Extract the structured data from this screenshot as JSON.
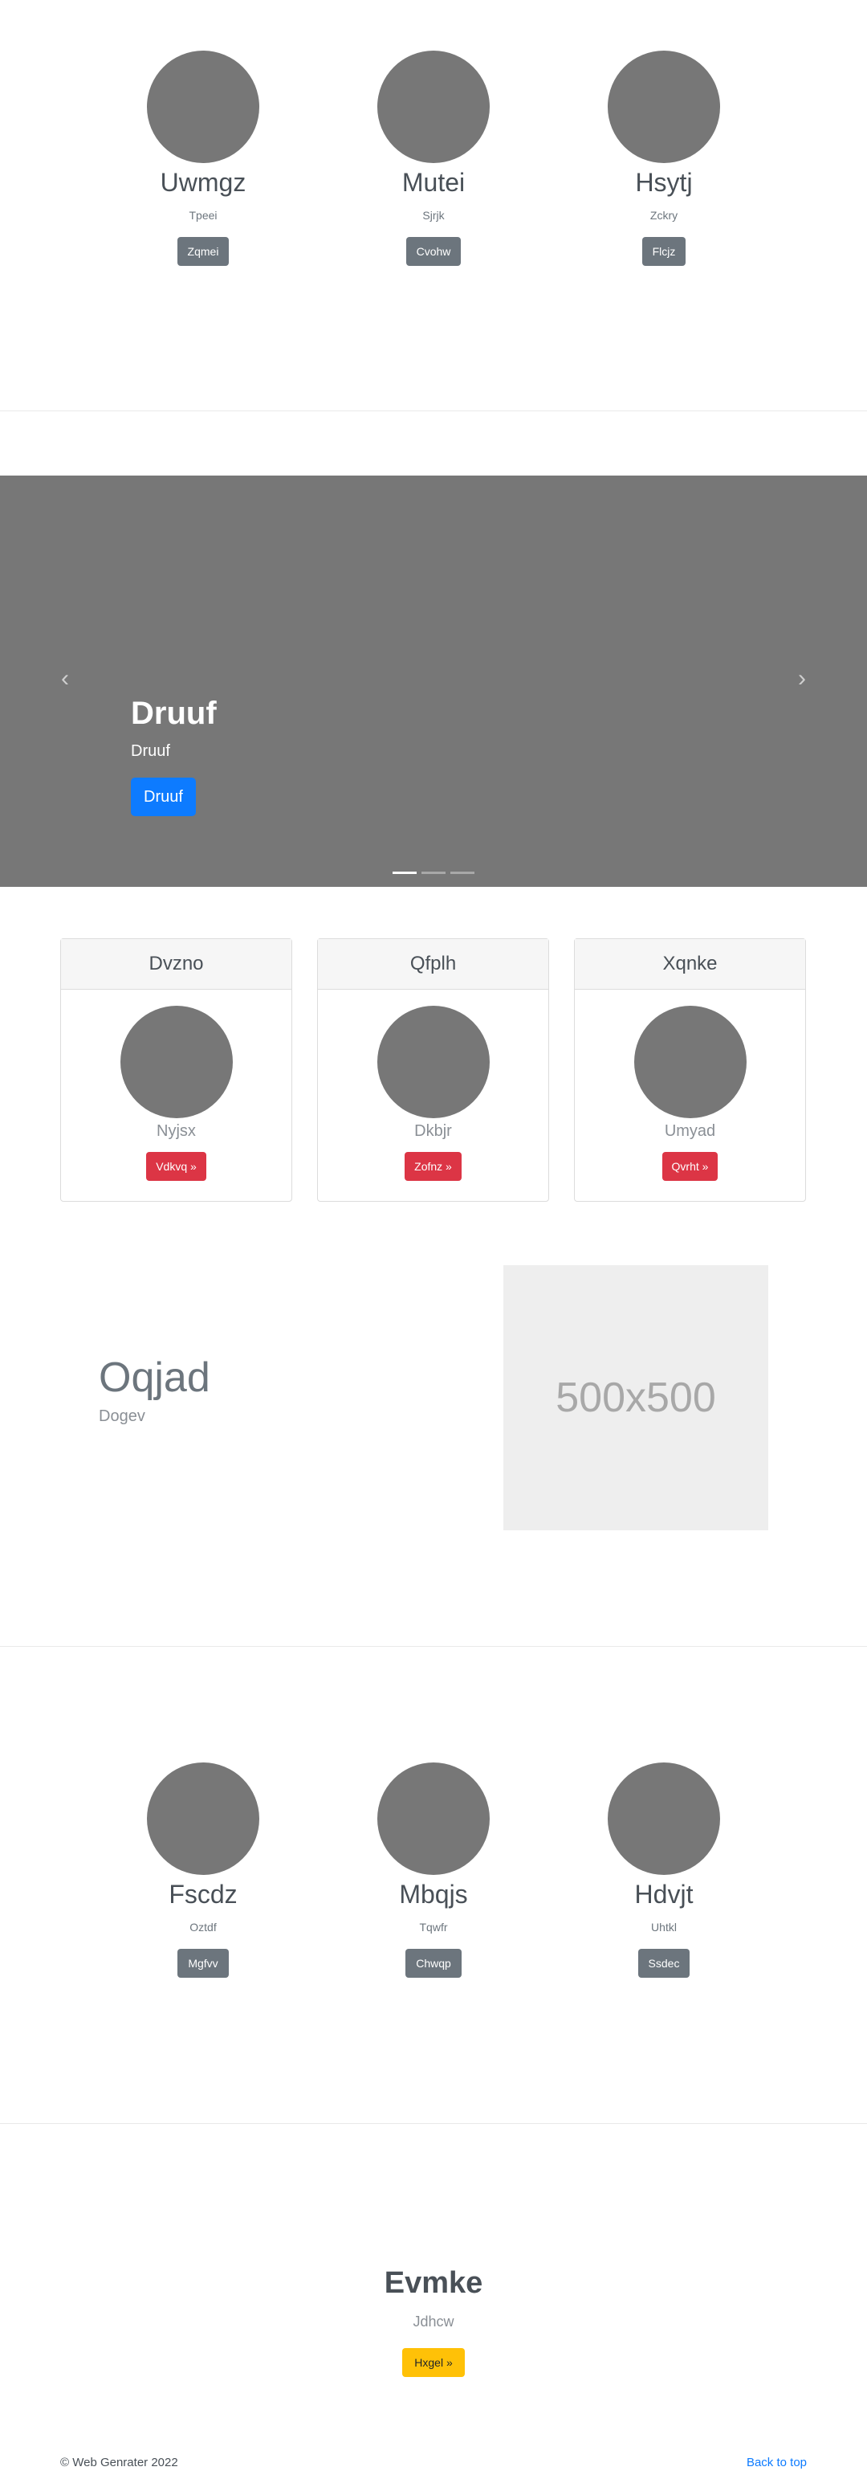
{
  "team_top": [
    {
      "name": "Uwmgz",
      "role": "Tpeei",
      "button": "Zqmei"
    },
    {
      "name": "Mutei",
      "role": "Sjrjk",
      "button": "Cvohw"
    },
    {
      "name": "Hsytj",
      "role": "Zckry",
      "button": "Flcjz"
    }
  ],
  "carousel": {
    "title": "Druuf",
    "subtitle": "Druuf",
    "button": "Druuf",
    "prev_icon": "‹",
    "next_icon": "›",
    "slide_count": 3,
    "active_slide": 1
  },
  "cards": [
    {
      "header": "Dvzno",
      "text": "Nyjsx",
      "button": "Vdkvq »"
    },
    {
      "header": "Qfplh",
      "text": "Dkbjr",
      "button": "Zofnz »"
    },
    {
      "header": "Xqnke",
      "text": "Umyad",
      "button": "Qvrht »"
    }
  ],
  "feature": {
    "title": "Oqjad",
    "subtitle": "Dogev",
    "placeholder_text": "500x500"
  },
  "team_bottom": [
    {
      "name": "Fscdz",
      "role": "Oztdf",
      "button": "Mgfvv"
    },
    {
      "name": "Mbqjs",
      "role": "Tqwfr",
      "button": "Chwqp"
    },
    {
      "name": "Hdvjt",
      "role": "Uhtkl",
      "button": "Ssdec"
    }
  ],
  "jumbotron": {
    "title": "Evmke",
    "subtitle": "Jdhcw",
    "button": "Hxgel »"
  },
  "footer": {
    "copyright": "© Web Genrater 2022",
    "back_to_top": "Back to top"
  },
  "colors": {
    "placeholder_grey": "#777777",
    "primary": "#0d7bff",
    "danger": "#dc3545",
    "secondary": "#6c757d",
    "warning": "#ffc107"
  }
}
